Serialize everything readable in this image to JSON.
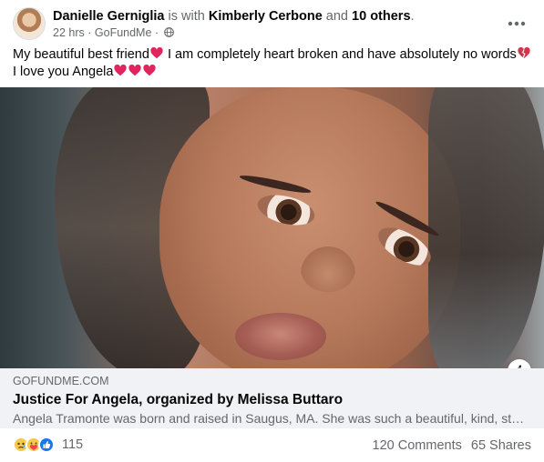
{
  "post": {
    "author": "Danielle Gerniglia",
    "with_text": "is with",
    "tagged": "Kimberly Cerbone",
    "and_text": "and",
    "others": "10 others",
    "period": ".",
    "time": "22 hrs",
    "separator": "·",
    "via": "GoFundMe",
    "separator2": "·",
    "text_part1": "My beautiful best friend",
    "text_part2": " I am completely heart broken and have absolutely no words",
    "text_part3": " I love you Angela",
    "icons": {
      "avatar": "avatar",
      "audience": "globe-icon",
      "more": "more-options-icon",
      "heart": "red-heart-emoji",
      "broken_heart": "broken-heart-emoji",
      "info": "info-icon"
    }
  },
  "link_preview": {
    "domain": "GOFUNDME.COM",
    "title": "Justice For Angela, organized by Melissa Buttaro",
    "description": "Angela Tramonte was born and raised in Saugus, MA. She was such a beautiful, kind, stron..."
  },
  "footer": {
    "reactions": [
      "sad-reaction-icon",
      "care-reaction-icon",
      "like-reaction-icon"
    ],
    "reaction_count": "115",
    "comments": "120 Comments",
    "shares": "65 Shares"
  },
  "colors": {
    "text_primary": "#050505",
    "text_secondary": "#65676b",
    "link_bg": "#f0f2f5",
    "like_blue": "#1877f2",
    "heart_red": "#e0245e"
  }
}
